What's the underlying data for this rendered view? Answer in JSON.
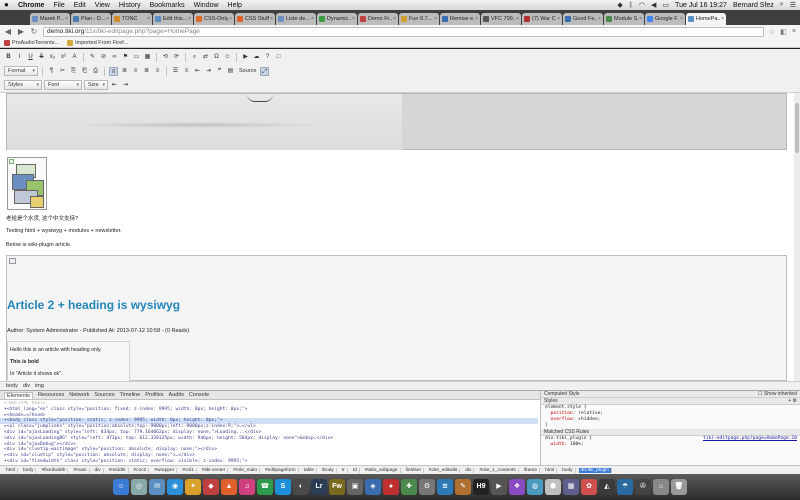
{
  "menubar": {
    "app": "Chrome",
    "items": [
      "File",
      "Edit",
      "View",
      "History",
      "Bookmarks",
      "Window",
      "Help"
    ],
    "clock": "Tue Jul 16  19:27",
    "user": "Bernard Sfez"
  },
  "tabs": [
    {
      "label": "Marek P...",
      "color": "#6d8fbf"
    },
    {
      "label": "Plan - D...",
      "color": "#4a7ab0"
    },
    {
      "label": "TONC",
      "color": "#d08b2c"
    },
    {
      "label": "Edit this...",
      "color": "#5b8fc2"
    },
    {
      "label": "CSS-Only...",
      "color": "#e06c2b"
    },
    {
      "label": "CSS Stuff...",
      "color": "#e0602b"
    },
    {
      "label": "Liste de...",
      "color": "#6d8fbf"
    },
    {
      "label": "Dynamic...",
      "color": "#3d9a3d"
    },
    {
      "label": "Demo Fr...",
      "color": "#c04040"
    },
    {
      "label": "Fun 8.7...",
      "color": "#d0a030"
    },
    {
      "label": "Remise e...",
      "color": "#3b6cb0"
    },
    {
      "label": "VFC 700...",
      "color": "#555"
    },
    {
      "label": "(7) War C...",
      "color": "#b03030"
    },
    {
      "label": "Good Fe...",
      "color": "#3b6cb0"
    },
    {
      "label": "Module S...",
      "color": "#4a8a4a"
    },
    {
      "label": "Google F...",
      "color": "#4285f4"
    },
    {
      "label": "HomePa...",
      "color": "#5b8fc2",
      "active": true
    }
  ],
  "omnibox": {
    "host": "demo.tiki.org",
    "path": "/11x/tiki-editpage.php?page=HomePage"
  },
  "bookmarks": [
    {
      "label": "ProAudioTorrents...",
      "color": "#c04040"
    },
    {
      "label": "Imported From Firef...",
      "color": "#d4a640"
    }
  ],
  "toolbar": {
    "row1": [
      "B",
      "I",
      "U",
      "S",
      "x₂",
      "x²",
      "A",
      "✎",
      "⊘",
      "∞",
      "⚑",
      "▭",
      "▦",
      "⟲",
      "⟳",
      "⌕",
      "⇄",
      "Ω",
      "☺",
      "▶",
      "☁",
      "?",
      "□"
    ],
    "format_label": "Format",
    "row2": [
      "¶",
      "✂",
      "⎘",
      "⎗",
      "⎙",
      "≡",
      "≣",
      "≡",
      "≣",
      "≡",
      "☰",
      "≡",
      "⇤",
      "⇥",
      "❝",
      "▤"
    ],
    "source_label": "Source",
    "styles_label": "Styles",
    "font_label": "Font",
    "size_label": "Size"
  },
  "content": {
    "chinese_line": "老给是个水货, 这个中文支持?",
    "testing_line": "Testing html + wysiwyg + modules + newsletter.",
    "below_line": "Below is wiki-plugin article.",
    "article_title": "Article 2 + heading is wysiwyg",
    "article_meta": "Author: System Administrator - Published At: 2013-07-12 10:58 - (0 Reads)",
    "inner_lines": [
      "Hello this is an article with heading only.",
      "This is bold",
      "In \"Article it shows ok\"."
    ]
  },
  "status_path": [
    "body",
    "div",
    "img"
  ],
  "devtools": {
    "tabs": [
      "Elements",
      "Resources",
      "Network",
      "Sources",
      "Timeline",
      "Profiles",
      "Audits",
      "Console"
    ],
    "dom": [
      {
        "text": "<!DOCTYPE html>",
        "kind": "cmt"
      },
      {
        "text": "▾<html lang=\"en\" class style=\"position: fixed; z-index: 9995; width: 0px; height: 0px;\">"
      },
      {
        "text": "  ▸<head>…</head>"
      },
      {
        "text": "  ▾<body class style=\"position: static; z-index: 9995; width: 0px; height: 0px;\">"
      },
      {
        "text": "    ▸<ul class=\"jumplinks\" style=\"position:absolute;top:-9000px;left:-9000px;z-index:9;\">…</ul>"
      },
      {
        "text": "    <div id=\"ajaxLoading\" style=\"left: 834px; top: 779.164062px; display: none;\">Loading...</div>"
      },
      {
        "text": "    <div id=\"ajaxLoadingBG\" style=\"left: 473px; top: 612.328125px; width: 946px; height: 584px; display: none\">&nbsp;</div>"
      },
      {
        "text": "    <div id=\"ajaxDebug\"></div>"
      },
      {
        "text": "    <div id=\"cluetip-waitimage\" style=\"position: absolute; display: none;\"></div>"
      },
      {
        "text": "    ▸<div id=\"cluetip\" style=\"position: absolute; display: none;\">…</div>"
      },
      {
        "text": "    ▾<div id=\"fixedwidth\" class style=\"position: static; overflow: visible; z-index: 9995;\">"
      }
    ],
    "crumbs": [
      "html",
      "body",
      "#fixedwidth",
      "#main",
      "div",
      "#middle",
      "#c1c2",
      "#wrapper",
      "#col1",
      "#tiki-center",
      "#role_main",
      "#editpageform",
      "table",
      "tbody",
      "tr",
      "td",
      "#tabs_editpage",
      "fieldset",
      "#cke_editwiki",
      "div",
      "#cke_1_contents",
      "iframe",
      "html",
      "body",
      "div.tiki_plugin"
    ],
    "styles": {
      "computed_label": "Computed Style",
      "show_inherited": "Show inherited",
      "styles_label": "Styles",
      "element_style": "element.style {",
      "rules": [
        {
          "prop": "position",
          "value": "relative;"
        },
        {
          "prop": "overflow",
          "value": "▸hidden;"
        }
      ],
      "close": "}",
      "matched_label": "Matched CSS Rules",
      "matched_selector": "div.tiki_plugin {",
      "matched_source": "tiki-editpage.php?page=HomePage:10",
      "matched_rules": [
        {
          "prop": "width",
          "value": "100%;"
        }
      ]
    }
  },
  "dock": [
    {
      "glyph": "☺",
      "color": "#3a7bd5"
    },
    {
      "glyph": "◎",
      "color": "#8aa"
    },
    {
      "glyph": "✉",
      "color": "#5b8fc2"
    },
    {
      "glyph": "◉",
      "color": "#2b8fd9"
    },
    {
      "glyph": "✦",
      "color": "#d9a02b"
    },
    {
      "glyph": "◆",
      "color": "#c04040"
    },
    {
      "glyph": "▲",
      "color": "#e0602b"
    },
    {
      "glyph": "♫",
      "color": "#d04080"
    },
    {
      "glyph": "☎",
      "color": "#2d9b4b"
    },
    {
      "glyph": "S",
      "color": "#1e90d9"
    },
    {
      "glyph": "◐",
      "color": "#4a4a4a"
    },
    {
      "glyph": "Lr",
      "color": "#2a3d55"
    },
    {
      "glyph": "Fw",
      "color": "#7a6a20"
    },
    {
      "glyph": "▣",
      "color": "#666"
    },
    {
      "glyph": "◈",
      "color": "#3b6cb0"
    },
    {
      "glyph": "●",
      "color": "#c03030"
    },
    {
      "glyph": "✚",
      "color": "#4a8a4a"
    },
    {
      "glyph": "⚙",
      "color": "#777"
    },
    {
      "glyph": "≋",
      "color": "#2c7bb6"
    },
    {
      "glyph": "✎",
      "color": "#b07030"
    },
    {
      "glyph": "H9",
      "color": "#222"
    },
    {
      "glyph": "▶",
      "color": "#555"
    },
    {
      "glyph": "❖",
      "color": "#8a4ac0"
    },
    {
      "glyph": "◍",
      "color": "#4a9ac0"
    },
    {
      "glyph": "⬢",
      "color": "#c0c0c0"
    },
    {
      "glyph": "▦",
      "color": "#606090"
    },
    {
      "glyph": "✿",
      "color": "#d05050"
    },
    {
      "glyph": "◭",
      "color": "#3a3a3a"
    },
    {
      "glyph": "☂",
      "color": "#2a6aa0"
    },
    {
      "glyph": "✇",
      "color": "#444"
    },
    {
      "glyph": "⌂",
      "color": "#888"
    },
    {
      "glyph": "🗑",
      "color": "#999"
    }
  ]
}
